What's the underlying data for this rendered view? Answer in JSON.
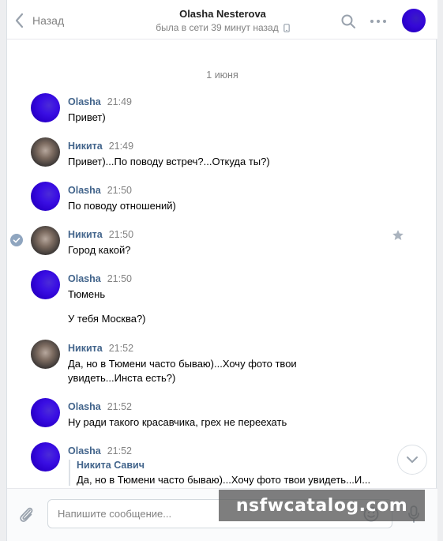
{
  "header": {
    "back_label": "Назад",
    "title": "Olasha Nesterova",
    "status": "была в сети 39 минут назад"
  },
  "date_divider": "1 июня",
  "messages": [
    {
      "sender": "Olasha",
      "time": "21:49",
      "text": "Привет)",
      "avatar": "olasha"
    },
    {
      "sender": "Никита",
      "time": "21:49",
      "text": "Привет)...По поводу встреч?...Откуда ты?)",
      "avatar": "nikita"
    },
    {
      "sender": "Olasha",
      "time": "21:50",
      "text": "По поводу отношений)",
      "avatar": "olasha"
    },
    {
      "sender": "Никита",
      "time": "21:50",
      "text": "Город какой?",
      "avatar": "nikita",
      "selected": true
    },
    {
      "sender": "Olasha",
      "time": "21:50",
      "text": "Тюмень",
      "text2": "У тебя Москва?)",
      "avatar": "olasha"
    },
    {
      "sender": "Никита",
      "time": "21:52",
      "text_line1": "Да, но в Тюмени часто бываю)...Хочу фото твои",
      "text_line2": "увидеть...Инста есть?)",
      "avatar": "nikita"
    },
    {
      "sender": "Olasha",
      "time": "21:52",
      "text": "Ну ради такого красавчика, грех не переехать",
      "avatar": "olasha"
    },
    {
      "sender": "Olasha",
      "time": "21:52",
      "avatar": "olasha",
      "quote": {
        "author": "Никита Савич",
        "text": "Да, но в Тюмени часто бываю)...Хочу фото твои увидеть...И..."
      }
    }
  ],
  "composer": {
    "placeholder": "Напишите сообщение..."
  },
  "watermark": "nsfwcatalog.com",
  "colors": {
    "accent": "#42648b",
    "muted": "#828282",
    "avatar_purple": "#3508d8"
  },
  "icons": [
    "back-chevron-icon",
    "phone-icon",
    "search-icon",
    "more-icon",
    "check-icon",
    "star-icon",
    "chevron-down-icon",
    "paperclip-icon",
    "emoji-icon",
    "mic-icon"
  ]
}
